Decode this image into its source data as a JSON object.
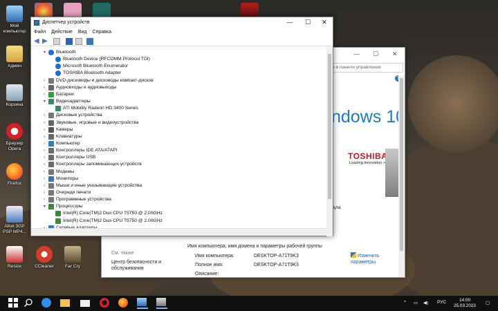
{
  "desktop": {
    "icons": [
      {
        "label": "Мой компьютер",
        "color": "#3f86c8",
        "icon": "computer-icon"
      },
      {
        "label": "Админ",
        "color": "#e8c45a",
        "icon": "user-folder-icon"
      },
      {
        "label": "Корзина",
        "color": "#9fb8cf",
        "icon": "recycle-bin-icon"
      },
      {
        "label": "Браузер Opera",
        "color": "#d81f26",
        "icon": "opera-icon"
      },
      {
        "label": "Firefox",
        "color": "#ff7a1a",
        "icon": "firefox-icon"
      },
      {
        "label": "Allok 3GP PSP MP4...",
        "color": "#4b79c8",
        "icon": "converter-icon"
      },
      {
        "label": "Resize",
        "color": "#c33",
        "icon": "resize-icon"
      },
      {
        "label": "CCleaner",
        "color": "#d83a2a",
        "icon": "ccleaner-icon"
      },
      {
        "label": "Far Cry",
        "color": "#7a6a48",
        "icon": "farcry-icon"
      }
    ]
  },
  "device_manager": {
    "title": "Диспетчер устройств",
    "menu": [
      "Файл",
      "Действие",
      "Вид",
      "Справка"
    ],
    "controls": {
      "minimize": "—",
      "maximize": "☐",
      "close": "✕"
    },
    "tree": [
      {
        "label": "Bluetooth",
        "level": 0,
        "expanded": true,
        "icon": "bluetooth-icon",
        "color": "#1a6fd0"
      },
      {
        "label": "Bluetooth Device (RFCOMM Protocol TDI)",
        "level": 1,
        "icon": "bluetooth-icon",
        "color": "#1a6fd0"
      },
      {
        "label": "Microsoft Bluetooth Enumerator",
        "level": 1,
        "icon": "bluetooth-icon",
        "color": "#1a6fd0"
      },
      {
        "label": "TOSHIBA Bluetooth Adapter",
        "level": 1,
        "icon": "bluetooth-icon",
        "color": "#1a6fd0"
      },
      {
        "label": "DVD-дисководы и дисководы компакт-дисков",
        "level": 0,
        "icon": "dvd-drive-icon",
        "color": "#777777"
      },
      {
        "label": "Аудиовходы и аудиовыходы",
        "level": 0,
        "icon": "speaker-icon",
        "color": "#666666"
      },
      {
        "label": "Батареи",
        "level": 0,
        "icon": "battery-icon",
        "color": "#3a9a3a"
      },
      {
        "label": "Видеоадаптеры",
        "level": 0,
        "expanded": true,
        "icon": "display-adapter-icon",
        "color": "#3a8a6a"
      },
      {
        "label": "ATI Mobility Radeon HD 3400 Series",
        "level": 1,
        "icon": "display-adapter-icon",
        "color": "#3a8a6a"
      },
      {
        "label": "Дисковые устройства",
        "level": 0,
        "icon": "disk-drive-icon",
        "color": "#777777"
      },
      {
        "label": "Звуковые, игровые и видеоустройства",
        "level": 0,
        "icon": "sound-icon",
        "color": "#666666"
      },
      {
        "label": "Камеры",
        "level": 0,
        "icon": "camera-icon",
        "color": "#555555"
      },
      {
        "label": "Клавиатуры",
        "level": 0,
        "icon": "keyboard-icon",
        "color": "#666666"
      },
      {
        "label": "Компьютер",
        "level": 0,
        "icon": "computer-icon",
        "color": "#3a78b8"
      },
      {
        "label": "Контроллеры IDE ATA/ATAPI",
        "level": 0,
        "icon": "controller-icon",
        "color": "#6a6a6a"
      },
      {
        "label": "Контроллеры USB",
        "level": 0,
        "icon": "usb-icon",
        "color": "#6a6a6a"
      },
      {
        "label": "Контроллеры запоминающих устройств",
        "level": 0,
        "icon": "storage-icon",
        "color": "#6a6a6a"
      },
      {
        "label": "Модемы",
        "level": 0,
        "icon": "modem-icon",
        "color": "#777777"
      },
      {
        "label": "Мониторы",
        "level": 0,
        "icon": "monitor-icon",
        "color": "#3a78b8"
      },
      {
        "label": "Мыши и иные указывающие устройства",
        "level": 0,
        "icon": "mouse-icon",
        "color": "#777777"
      },
      {
        "label": "Очереди печати",
        "level": 0,
        "icon": "printer-icon",
        "color": "#777777"
      },
      {
        "label": "Программные устройства",
        "level": 0,
        "icon": "software-device-icon",
        "color": "#777777"
      },
      {
        "label": "Процессоры",
        "level": 0,
        "expanded": true,
        "icon": "processor-icon",
        "color": "#3a8a3a"
      },
      {
        "label": "Intel(R) Core(TM)2 Duo CPU     T5750  @ 2.00GHz",
        "level": 1,
        "icon": "processor-icon",
        "color": "#3a8a3a"
      },
      {
        "label": "Intel(R) Core(TM)2 Duo CPU     T5750  @ 2.00GHz",
        "level": 1,
        "icon": "processor-icon",
        "color": "#3a8a3a"
      },
      {
        "label": "Сетевые адаптеры",
        "level": 0,
        "icon": "network-adapter-icon",
        "color": "#3a78b8"
      }
    ]
  },
  "system_window": {
    "search_placeholder": "к в панели управления",
    "controls": {
      "minimize": "—",
      "maximize": "☐",
      "close": "✕"
    },
    "help": "?",
    "windows_brand": "ndows 10",
    "toshiba": "TOSHIBA",
    "toshiba_tagline": "Leading Innovation >>>",
    "dla": "дла",
    "group_title": "Имя компьютера, имя домена и параметры рабочей группы",
    "see_also": "См. также",
    "security_link": "Центр безопасности и обслуживания",
    "fields": [
      {
        "label": "Имя компьютера:",
        "value": "DESKTOP-A71T9K3"
      },
      {
        "label": "Полное имя:",
        "value": "DESKTOP-A71T9K3"
      },
      {
        "label": "Описание:",
        "value": ""
      }
    ],
    "change_link": "Изменить параметры"
  },
  "taskbar": {
    "apps": [
      "start-icon",
      "search-icon",
      "edge-icon",
      "file-explorer-icon",
      "mail-icon",
      "opera-icon",
      "firefox-icon",
      "control-panel-icon",
      "device-manager-icon"
    ],
    "language": "РУС",
    "time": "14:00",
    "date": "25.03.2023"
  }
}
